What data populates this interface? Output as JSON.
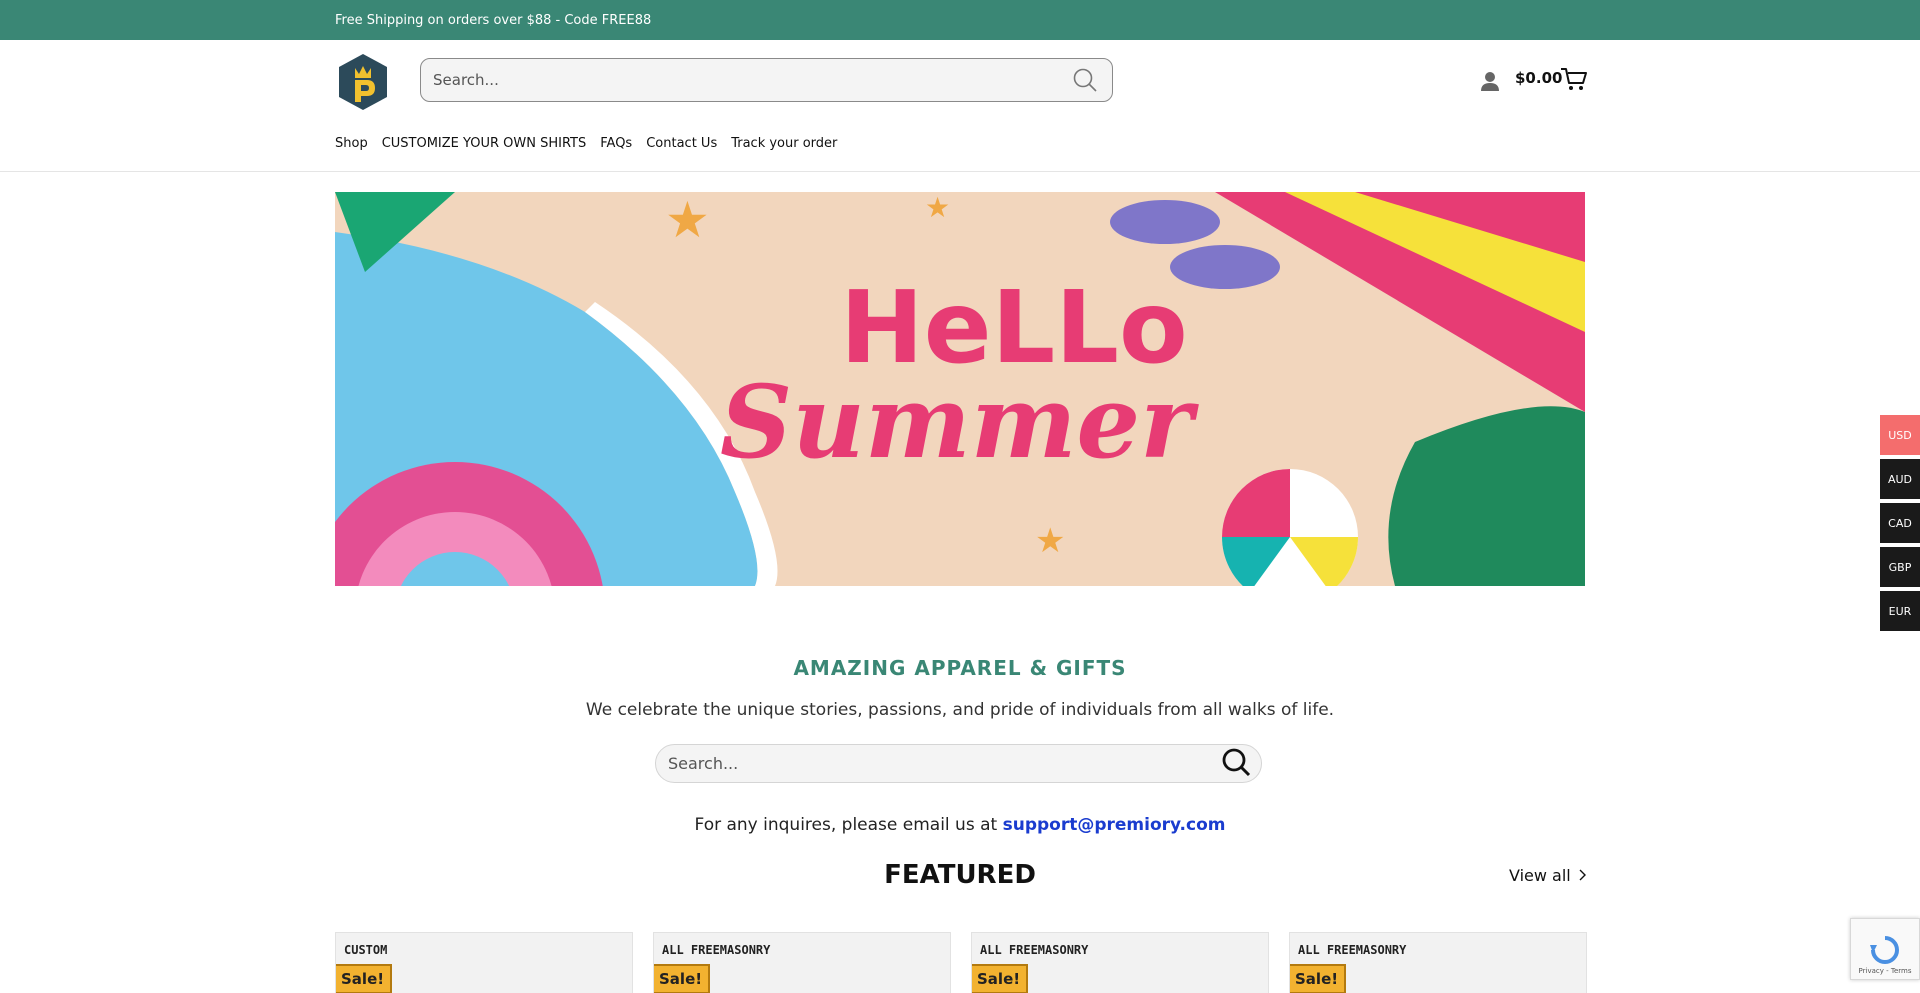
{
  "topbar": {
    "text": "Free Shipping on orders over $88 - Code FREE88"
  },
  "header": {
    "search_placeholder": "Search...",
    "cart_total": "$0.00"
  },
  "nav": {
    "items": [
      "Shop",
      "CUSTOMIZE YOUR OWN SHIRTS",
      "FAQs",
      "Contact Us",
      "Track your order"
    ]
  },
  "banner": {
    "line1": "HeLLo",
    "line2": "Summer"
  },
  "intro": {
    "tagline": "AMAZING APPAREL & GIFTS",
    "subtext": "We celebrate the unique stories, passions, and pride of individuals from all walks of life.",
    "search_placeholder": "Search...",
    "inquire_prefix": "For any inquires, please email us at ",
    "email": "support@premiory.com"
  },
  "featured": {
    "title": "FEATURED",
    "view_all": "View all"
  },
  "products": [
    {
      "thumb_text": "CUSTOM",
      "sale": "Sale!"
    },
    {
      "thumb_text": "ALL FREEMASONRY",
      "sale": "Sale!"
    },
    {
      "thumb_text": "ALL FREEMASONRY",
      "sale": "Sale!"
    },
    {
      "thumb_text": "ALL FREEMASONRY",
      "sale": "Sale!"
    }
  ],
  "currencies": [
    "USD",
    "AUD",
    "CAD",
    "GBP",
    "EUR"
  ],
  "recaptcha": {
    "text": "Privacy - Terms"
  },
  "colors": {
    "brand": "#3a8775",
    "accent": "#f46d6d",
    "link": "#1a3ccf"
  }
}
